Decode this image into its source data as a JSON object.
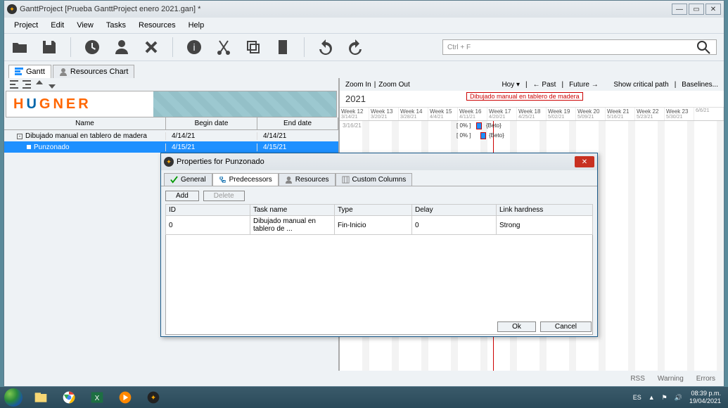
{
  "window": {
    "title": "GanttProject [Prueba GanttProject enero 2021.gan] *"
  },
  "menu": {
    "project": "Project",
    "edit": "Edit",
    "view": "View",
    "tasks": "Tasks",
    "resources": "Resources",
    "help": "Help"
  },
  "search": {
    "placeholder": "Ctrl + F"
  },
  "view_tabs": {
    "gantt": "Gantt",
    "resources": "Resources Chart"
  },
  "task_table": {
    "col_name": "Name",
    "col_begin": "Begin date",
    "col_end": "End date",
    "rows": [
      {
        "name": "Dibujado manual en tablero de madera",
        "begin": "4/14/21",
        "end": "4/14/21"
      },
      {
        "name": "Punzonado",
        "begin": "4/15/21",
        "end": "4/15/21"
      }
    ]
  },
  "zoom": {
    "in": "Zoom In",
    "out": "Zoom Out",
    "hoy": "Hoy",
    "past": "← Past",
    "future": "Future →",
    "crit": "Show critical path",
    "base": "Baselines..."
  },
  "year": "2021",
  "phase_label": "Dibujado manual en tablero de madera",
  "weeks": [
    {
      "w": "Week 12",
      "d": "3/14/21"
    },
    {
      "w": "Week 13",
      "d": "3/20/21"
    },
    {
      "w": "Week 14",
      "d": "3/28/21"
    },
    {
      "w": "Week 15",
      "d": "4/4/21"
    },
    {
      "w": "Week 16",
      "d": "4/11/21"
    },
    {
      "w": "Week 17",
      "d": "4/20/21"
    },
    {
      "w": "Week 18",
      "d": "4/25/21"
    },
    {
      "w": "Week 19",
      "d": "5/02/21"
    },
    {
      "w": "Week 20",
      "d": "5/09/21"
    },
    {
      "w": "Week 21",
      "d": "5/16/21"
    },
    {
      "w": "Week 22",
      "d": "5/23/21"
    },
    {
      "w": "Week 23",
      "d": "5/30/21"
    },
    {
      "w": "",
      "d": "6/6/21"
    }
  ],
  "gantt_rows": [
    {
      "pct": "[ 0% ]",
      "res": "{Beto}"
    },
    {
      "pct": "[ 0% ]",
      "res": "{Beto}"
    }
  ],
  "gantt_date0": "3/16/21",
  "dialog": {
    "title": "Properties for Punzonado",
    "tabs": {
      "general": "General",
      "pred": "Predecessors",
      "res": "Resources",
      "cc": "Custom Columns"
    },
    "add": "Add",
    "delete": "Delete",
    "cols": {
      "id": "ID",
      "task": "Task name",
      "type": "Type",
      "delay": "Delay",
      "link": "Link hardness"
    },
    "row": {
      "id": "0",
      "task": "Dibujado manual en tablero de ...",
      "type": "Fin-Inicio",
      "delay": "0",
      "link": "Strong"
    },
    "ok": "Ok",
    "cancel": "Cancel"
  },
  "status": {
    "rss": "RSS",
    "warn": "Warning",
    "err": "Errors"
  },
  "tray": {
    "lang": "ES",
    "time": "08:39 p.m.",
    "date": "19/04/2021"
  }
}
